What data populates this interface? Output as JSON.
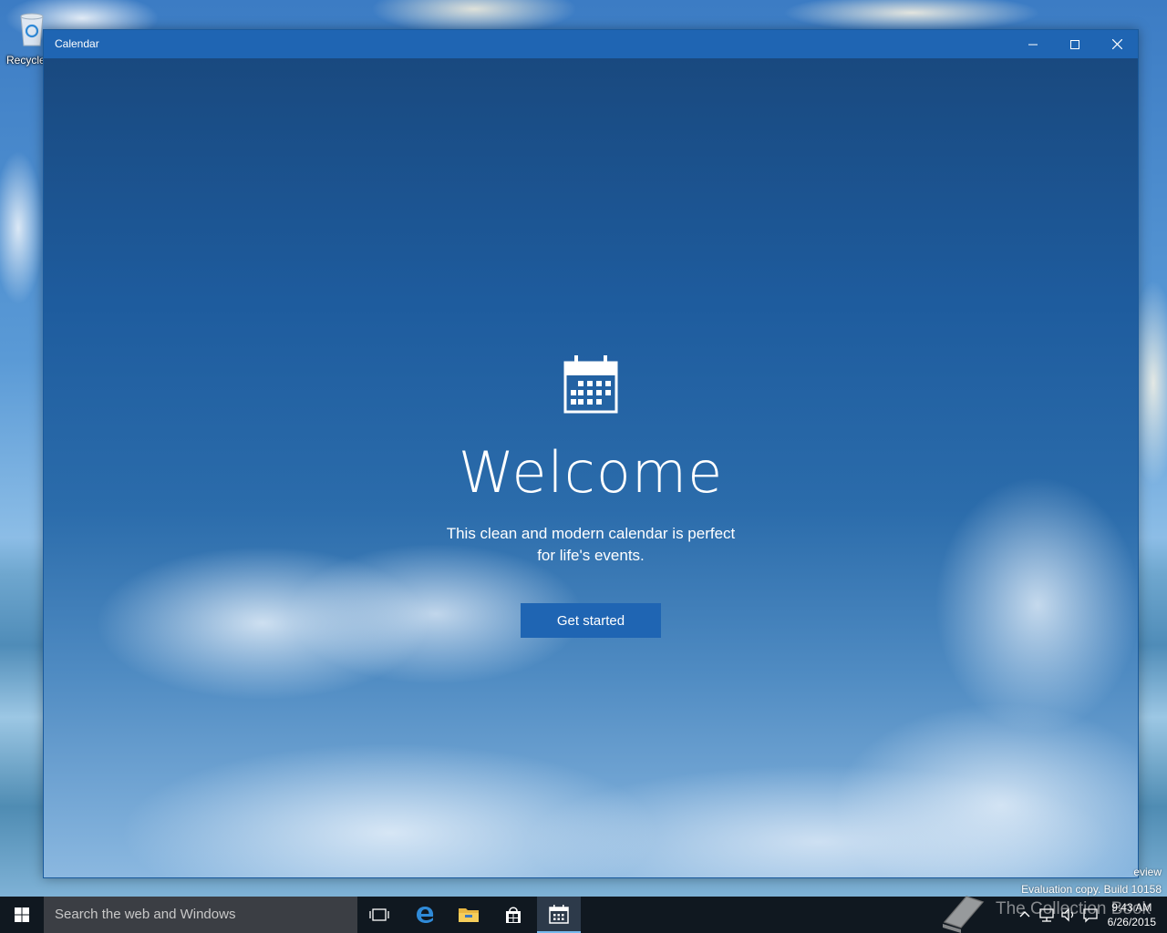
{
  "desktop": {
    "recycle_bin_label": "Recycle"
  },
  "window": {
    "title": "Calendar",
    "minimize_icon": "minimize-icon",
    "maximize_icon": "maximize-icon",
    "close_icon": "close-icon"
  },
  "welcome": {
    "icon": "calendar-icon",
    "title": "Welcome",
    "subtitle_line1": "This clean and modern calendar is perfect",
    "subtitle_line2": "for life's events.",
    "button_label": "Get started"
  },
  "watermark": {
    "line1": "eview",
    "line2": "Evaluation copy. Build 10158"
  },
  "taskbar": {
    "start_icon": "windows-logo-icon",
    "search_placeholder": "Search the web and Windows",
    "pinned": [
      "task-view-icon",
      "edge-icon",
      "file-explorer-icon",
      "store-icon",
      "calendar-icon"
    ],
    "active_app": "Calendar",
    "clock_time": "9:43 AM",
    "clock_date": "6/26/2015"
  },
  "brand_overlay": {
    "text": "The Collection Book"
  },
  "colors": {
    "accent": "#1f65b3",
    "taskbar": "#101820",
    "search_box": "#3b3e44"
  }
}
